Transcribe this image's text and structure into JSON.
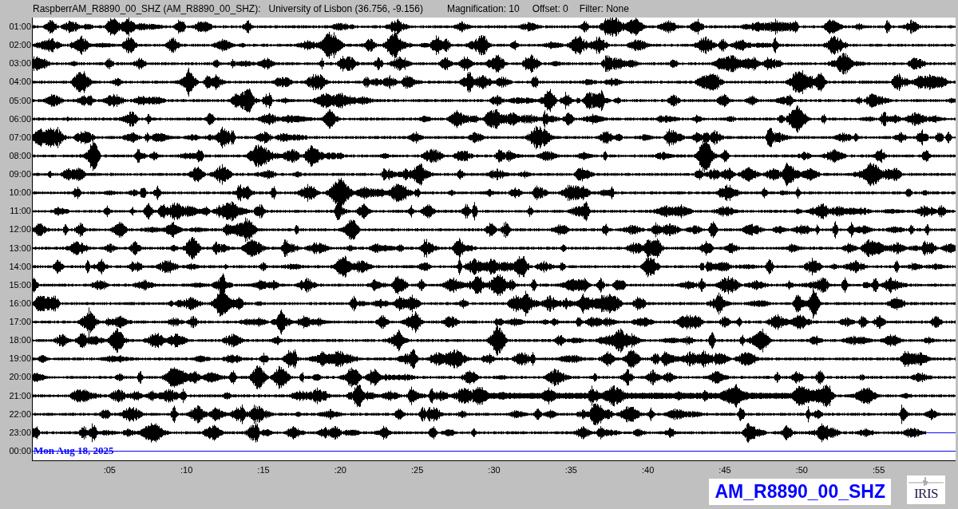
{
  "header": {
    "station": "RaspberrAM_R8890_00_SHZ (AM_R8890_00_SHZ):",
    "location": "University of Lisbon (36.756, -9.156)",
    "magnification": "Magnification: 10",
    "offset": "Offset: 0",
    "filter": "Filter: None"
  },
  "rows": [
    {
      "time": "01:00",
      "kind": "trace"
    },
    {
      "time": "02:00",
      "kind": "trace"
    },
    {
      "time": "03:00",
      "kind": "trace"
    },
    {
      "time": "04:00",
      "kind": "trace"
    },
    {
      "time": "05:00",
      "kind": "trace"
    },
    {
      "time": "06:00",
      "kind": "trace"
    },
    {
      "time": "07:00",
      "kind": "trace"
    },
    {
      "time": "08:00",
      "kind": "trace"
    },
    {
      "time": "09:00",
      "kind": "trace"
    },
    {
      "time": "10:00",
      "kind": "trace"
    },
    {
      "time": "11:00",
      "kind": "trace"
    },
    {
      "time": "12:00",
      "kind": "trace"
    },
    {
      "time": "13:00",
      "kind": "trace"
    },
    {
      "time": "14:00",
      "kind": "trace"
    },
    {
      "time": "15:00",
      "kind": "trace"
    },
    {
      "time": "16:00",
      "kind": "trace"
    },
    {
      "time": "17:00",
      "kind": "trace"
    },
    {
      "time": "18:00",
      "kind": "trace"
    },
    {
      "time": "19:00",
      "kind": "trace"
    },
    {
      "time": "20:00",
      "kind": "trace"
    },
    {
      "time": "21:00",
      "kind": "trace"
    },
    {
      "time": "22:00",
      "kind": "trace"
    },
    {
      "time": "23:00",
      "kind": "partial"
    },
    {
      "time": "00:00",
      "kind": "current"
    }
  ],
  "date": "Mon Aug 18, 2025",
  "x_ticks": [
    ":05",
    ":10",
    ":15",
    ":20",
    ":25",
    ":30",
    ":35",
    ":40",
    ":45",
    ":50",
    ":55"
  ],
  "station_label": "AM_R8890_00_SHZ",
  "logo": "IRIS"
}
